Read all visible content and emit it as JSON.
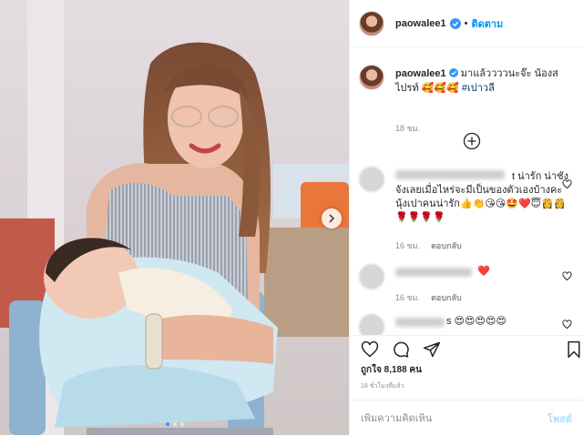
{
  "header": {
    "username": "paowalee1",
    "separator": "•",
    "follow_label": "ติดตาม"
  },
  "caption": {
    "username": "paowalee1",
    "text": "มาแล้ววววนะจ๊ะ น้องสไปรท์ 🥰🥰🥰",
    "hashtag": "#เปาวลี",
    "time": "18 ชม."
  },
  "comments": [
    {
      "text": "t น่ารัก น่าชังจังเลยเมื่อไหร่จะมีเป็นของตัวเองบ้างคะนุ้งเปาคนน่ารัก👍👏😘😘🤩❤️😇👸👸🌹🌹🌹🌹",
      "time": "16 ชม.",
      "reply_label": "ตอบกลับ"
    },
    {
      "text": "❤️",
      "time": "16 ชม.",
      "reply_label": "ตอบกลับ"
    },
    {
      "text": "s 😍😍😍😍😍",
      "time": "",
      "reply_label": ""
    }
  ],
  "likes_text": "ถูกใจ 8,188 คน",
  "posted_time": "18 ชั่วโมงที่แล้ว",
  "add_comment": {
    "placeholder": "เพิ่มความคิดเห็น",
    "post_label": "โพสต์"
  },
  "carousel": {
    "total": 3,
    "active": 1
  },
  "colors": {
    "link": "#0095f6",
    "verified": "#3897f0",
    "heart": "#ed4956",
    "muted": "#8e8e8e"
  },
  "icons": [
    "verified-badge-icon",
    "chevron-right-icon",
    "load-more-plus-icon",
    "heart-icon",
    "comment-icon",
    "share-icon",
    "bookmark-icon"
  ]
}
